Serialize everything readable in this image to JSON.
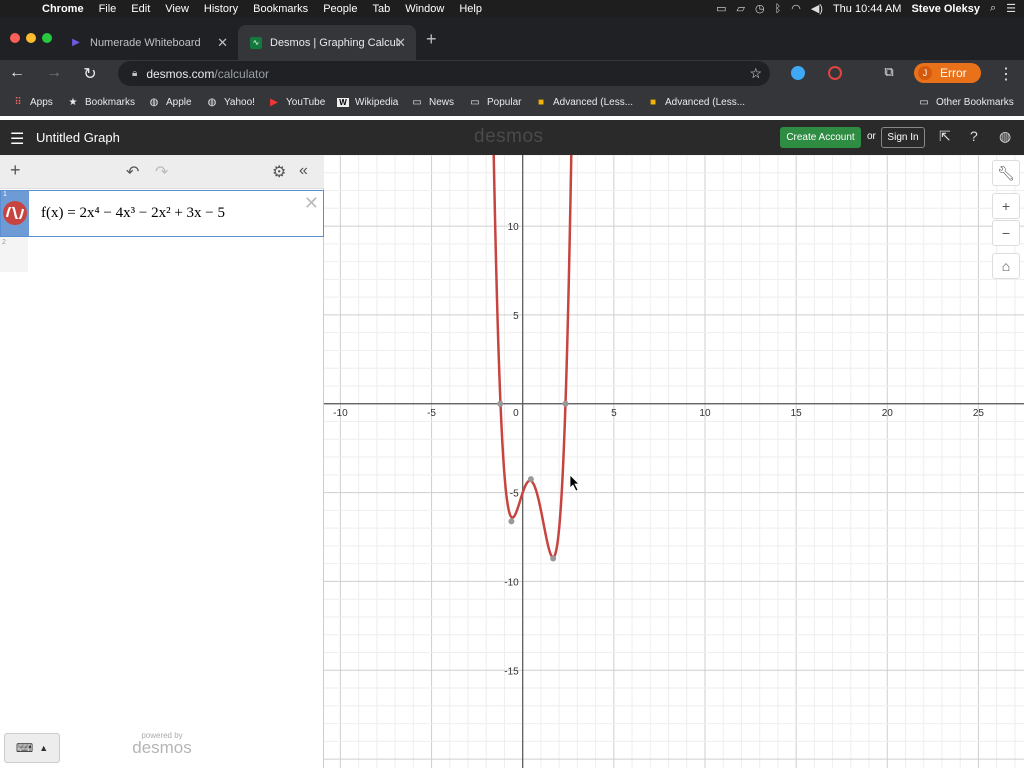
{
  "menubar": {
    "app": "Chrome",
    "items": [
      "File",
      "Edit",
      "View",
      "History",
      "Bookmarks",
      "People",
      "Tab",
      "Window",
      "Help"
    ],
    "clock": "Thu 10:44 AM",
    "user": "Steve Oleksy"
  },
  "tabs": [
    {
      "title": "Numerade Whiteboard",
      "active": false
    },
    {
      "title": "Desmos | Graphing Calculator",
      "active": true
    }
  ],
  "omnibox": {
    "host": "desmos.com",
    "path": "/calculator"
  },
  "profile": {
    "initial": "J",
    "status": "Error"
  },
  "bookmarks": {
    "items": [
      "Apps",
      "Bookmarks",
      "Apple",
      "Yahoo!",
      "YouTube",
      "Wikipedia",
      "News",
      "Popular",
      "Advanced (Less...",
      "Advanced (Less..."
    ],
    "other": "Other Bookmarks"
  },
  "desmos": {
    "graph_title": "Untitled Graph",
    "logo": "desmos",
    "create_account": "Create Account",
    "or": "or",
    "sign_in": "Sign In"
  },
  "expressions": [
    {
      "index": "1",
      "latex_display": "f(x) = 2x⁴ − 4x³ − 2x² + 3x − 5",
      "color": "#c74440"
    },
    {
      "index": "2",
      "latex_display": ""
    }
  ],
  "powered_by": {
    "small": "powered by",
    "logo": "desmos"
  },
  "graph": {
    "x_ticks": [
      "-10",
      "-5",
      "0",
      "5",
      "10",
      "15",
      "20",
      "25"
    ],
    "y_ticks": [
      "10",
      "5",
      "-5",
      "-10",
      "-15"
    ],
    "curve_color": "#c74440"
  },
  "chart_data": {
    "type": "line",
    "title": "",
    "xlabel": "",
    "ylabel": "",
    "xlim": [
      -10.9,
      27.5
    ],
    "ylim": [
      -20.5,
      14
    ],
    "function": "2x^4 - 4x^3 - 2x^2 + 3x - 5",
    "points_of_interest": [
      {
        "x": -1.23,
        "y": 0
      },
      {
        "x": -0.62,
        "y": -6.62
      },
      {
        "x": 0.45,
        "y": -4.24
      },
      {
        "x": 1.67,
        "y": -8.71
      },
      {
        "x": 2.35,
        "y": 0
      }
    ],
    "grid": true
  }
}
